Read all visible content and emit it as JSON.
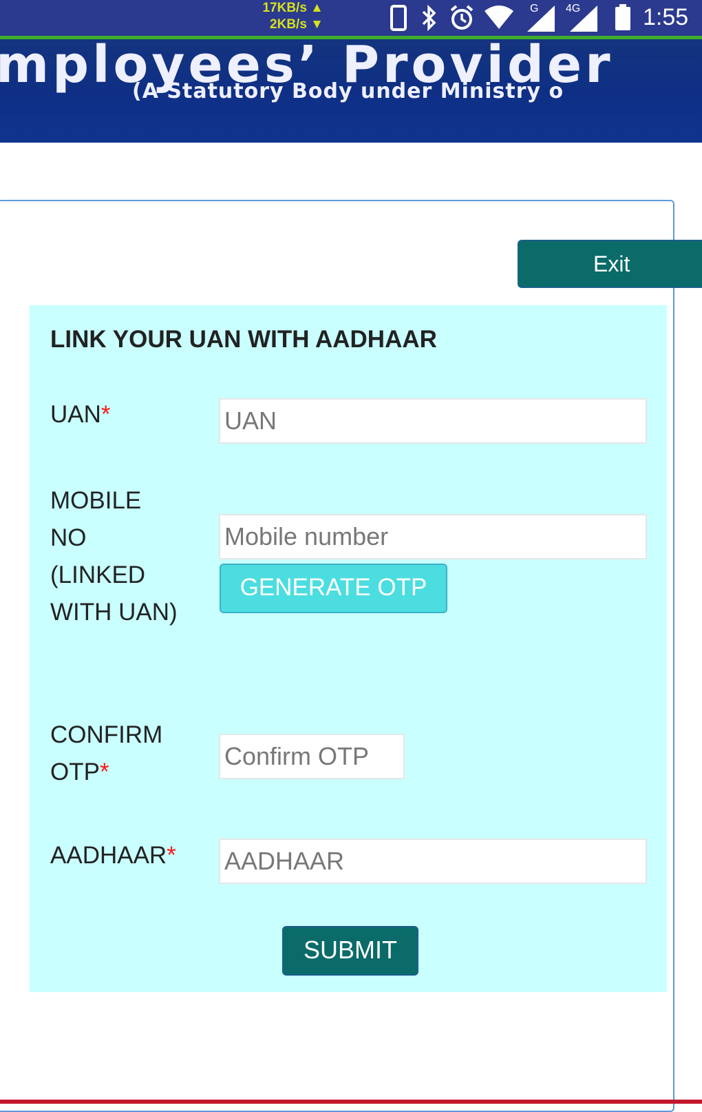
{
  "status_bar": {
    "upload_speed": "17KB/s ▲",
    "download_speed": "2KB/s ▼",
    "network_g": "G",
    "network_4g": "4G",
    "time": "1:55"
  },
  "header": {
    "title": "mployees’ Provider",
    "subtitle": "(A Statutory Body under Ministry o"
  },
  "exit_label": "Exit",
  "form": {
    "title": "LINK YOUR UAN WITH AADHAAR",
    "required_mark": "*",
    "uan": {
      "label": "UAN",
      "placeholder": "UAN"
    },
    "mobile": {
      "label_lines": [
        "MOBILE",
        "NO",
        "(LINKED",
        "WITH UAN)"
      ],
      "placeholder": "Mobile number",
      "button_label": "GENERATE OTP"
    },
    "confirm_otp": {
      "label_lines": [
        "CONFIRM",
        "OTP"
      ],
      "placeholder": "Confirm OTP"
    },
    "aadhaar": {
      "label": "AADHAAR",
      "placeholder": "AADHAAR"
    },
    "submit_label": "SUBMIT"
  },
  "colors": {
    "status_bar_bg": "#2b3a8f",
    "banner_bg": "#10348f",
    "panel_bg": "#c9ffff",
    "primary_button": "#0b6b69",
    "otp_button": "#4cdde0",
    "required": "#ff1a1a",
    "bottom_bar": "#c3172d"
  }
}
